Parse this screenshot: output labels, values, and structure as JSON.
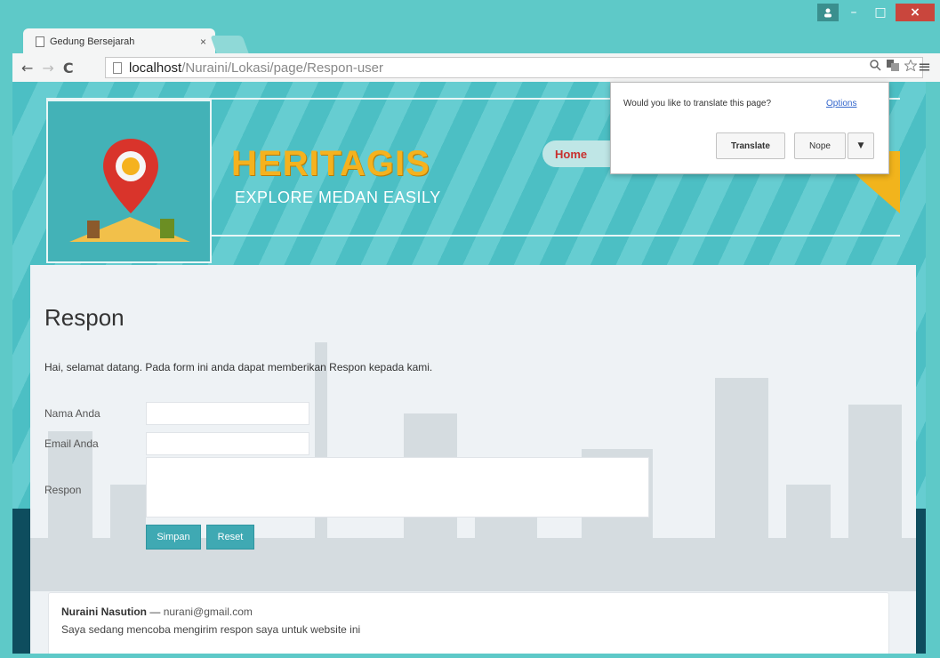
{
  "window": {
    "minimize_glyph": "–",
    "maximize_glyph": "□",
    "close_glyph": "×"
  },
  "tab": {
    "title": "Gedung Bersejarah",
    "close_glyph": "×"
  },
  "toolbar": {
    "back_glyph": "←",
    "forward_glyph": "→",
    "reload_glyph": "C",
    "url_host": "localhost",
    "url_path": "/Nuraini/Lokasi/page/Respon-user",
    "menu_glyph": "≡"
  },
  "translate_bar": {
    "question": "Would you like to translate this page?",
    "options_link": "Options",
    "translate_label": "Translate",
    "nope_label": "Nope",
    "dropdown_glyph": "▼"
  },
  "header": {
    "brand": "HERITAGIS",
    "tagline": "EXPLORE MEDAN EASILY",
    "nav_home": "Home"
  },
  "main": {
    "title": "Respon",
    "intro": "Hai, selamat datang. Pada form ini anda dapat memberikan Respon kepada kami.",
    "form": {
      "name_label": "Nama Anda",
      "email_label": "Email Anda",
      "respon_label": "Respon",
      "submit_label": "Simpan",
      "reset_label": "Reset"
    },
    "comment": {
      "author": "Nuraini Nasution",
      "separator": " — ",
      "email": "nurani@gmail.com",
      "text": "Saya sedang mencoba mengirim respon saya untuk website ini"
    }
  },
  "colors": {
    "accent": "#3fa9b3",
    "brand_yellow": "#f5b21e",
    "nav_red": "#c8302e",
    "frame": "#5ec9c8"
  }
}
